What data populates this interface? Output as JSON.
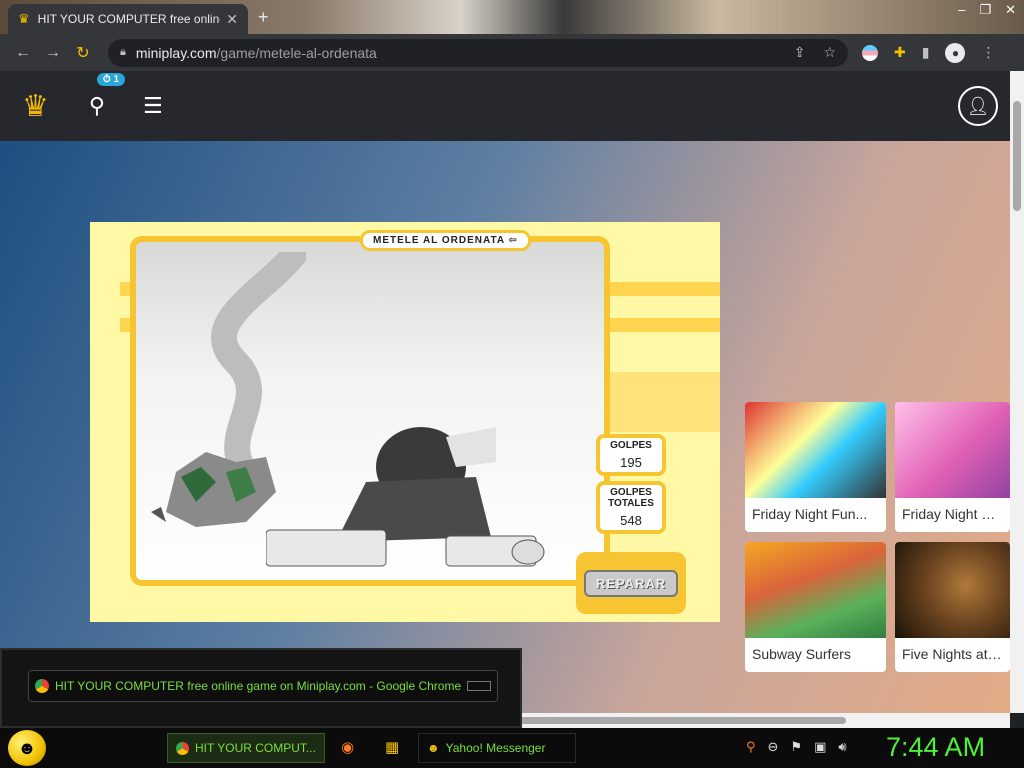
{
  "browser": {
    "tab_title": "HIT YOUR COMPUTER free online game on Miniplay.com",
    "url_host": "miniplay.com",
    "url_path": "/game/metele-al-ordenata"
  },
  "site": {
    "notification_badge": "1"
  },
  "game": {
    "title": "METELE AL ORDENATA",
    "golpes_label": "GOLPES",
    "golpes_value": "195",
    "golpes_totales_label_1": "GOLPES",
    "golpes_totales_label_2": "TOTALES",
    "golpes_totales_value": "548",
    "repair_label": "REPARAR"
  },
  "cards": [
    {
      "name": "Friday Night Fun..."
    },
    {
      "name": "Friday Night Fun"
    },
    {
      "name": "Subway Surfers"
    },
    {
      "name": "Five Nights at Fr"
    }
  ],
  "tooltip": {
    "text": "HIT YOUR COMPUTER free online game on Miniplay.com - Google Chrome"
  },
  "taskbar": {
    "active_task": "HIT YOUR COMPUT...",
    "messenger_task": "Yahoo! Messenger",
    "clock": "7:44 AM"
  },
  "icons": [
    "crown-icon",
    "search-icon",
    "menu-icon",
    "user-icon",
    "lock-icon",
    "star-icon",
    "share-icon",
    "extensions-icon",
    "smiley-icon",
    "firefox-icon",
    "folder-icon",
    "volume-icon",
    "network-icon"
  ]
}
